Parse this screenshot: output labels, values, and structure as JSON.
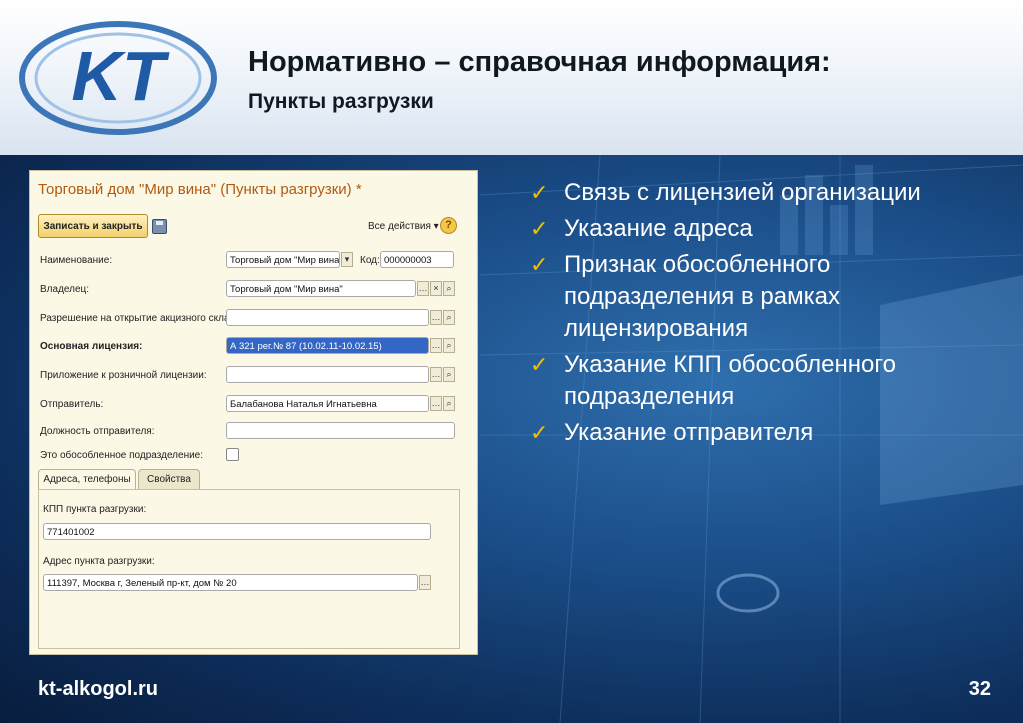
{
  "header": {
    "title": "Нормативно – справочная информация:",
    "subtitle": "Пункты разгрузки",
    "logo_text": "KT"
  },
  "form": {
    "window_title": "Торговый дом \"Мир вина\" (Пункты разгрузки) *",
    "save_close_label": "Записать и закрыть",
    "all_actions_label": "Все действия ▾",
    "help_label": "?",
    "fields": {
      "name": {
        "label": "Наименование:",
        "value": "Торговый дом \"Мир вина\""
      },
      "code": {
        "label": "Код:",
        "value": "000000003"
      },
      "owner": {
        "label": "Владелец:",
        "value": "Торговый дом \"Мир вина\""
      },
      "excise_permit": {
        "label": "Разрешение на открытие акцизного склада:",
        "value": ""
      },
      "main_license": {
        "label": "Основная лицензия:",
        "value": "А 321 рег.№ 87 (10.02.11-10.02.15)"
      },
      "retail_app": {
        "label": "Приложение к розничной лицензии:",
        "value": ""
      },
      "sender": {
        "label": "Отправитель:",
        "value": "Балабанова Наталья Игнатьевна"
      },
      "sender_position": {
        "label": "Должность отправителя:",
        "value": ""
      },
      "separate_unit": {
        "label": "Это обособленное подразделение:",
        "checked": false
      }
    },
    "tabs": [
      {
        "label": "Адреса, телефоны",
        "active": true
      },
      {
        "label": "Свойства",
        "active": false
      }
    ],
    "tab_content": {
      "kpp_label": "КПП пункта разгрузки:",
      "kpp_value": "771401002",
      "address_label": "Адрес пункта разгрузки:",
      "address_value": "111397, Москва г, Зеленый пр-кт, дом № 20"
    }
  },
  "bullets": [
    "Связь с лицензией организации",
    "Указание адреса",
    "Признак обособленного подразделения в рамках лицензирования",
    "Указание КПП обособленного подразделения",
    "Указание отправителя"
  ],
  "footer": {
    "url": "kt-alkogol.ru",
    "page": "32"
  },
  "colors": {
    "accent_check": "#f0c000",
    "header_bg": "#ffffff",
    "stage_bg": "#1a4c86",
    "window_title": "#b25a12",
    "selection": "#3467c5"
  }
}
